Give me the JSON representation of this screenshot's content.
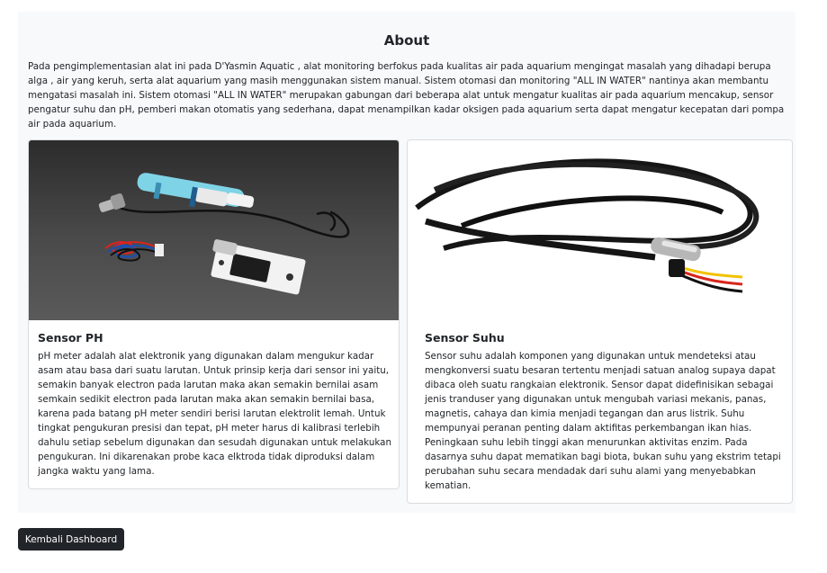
{
  "about": {
    "title": "About",
    "description": "Pada pengimplementasian alat ini pada D'Yasmin Aquatic , alat monitoring berfokus pada kualitas air pada aquarium mengingat masalah yang dihadapi berupa alga , air yang keruh, serta alat aquarium yang masih menggunakan sistem manual. Sistem otomasi dan monitoring \"ALL IN WATER\" nantinya akan membantu mengatasi masalah ini. Sistem otomasi \"ALL IN WATER\" merupakan gabungan dari beberapa alat untuk mengatur kualitas air pada aquarium mencakup, sensor pengatur suhu dan pH, pemberi makan otomatis yang sederhana, dapat menampilkan kadar oksigen pada aquarium serta dapat mengatur kecepatan dari pompa air pada aquarium."
  },
  "cards": [
    {
      "title": "Sensor PH",
      "text": "pH meter adalah alat elektronik yang digunakan dalam mengukur kadar asam atau basa dari suatu larutan. Untuk prinsip kerja dari sensor ini yaitu, semakin banyak electron pada larutan maka akan semakin bernilai asam semkain sedikit electron pada larutan maka akan semakin bernilai basa, karena pada batang pH meter sendiri berisi larutan elektrolit lemah. Untuk tingkat pengukuran presisi dan tepat, pH meter harus di kalibrasi terlebih dahulu setiap sebelum digunakan dan sesudah digunakan untuk melakukan pengukuran. Ini dikarenakan probe kaca elktroda tidak diproduksi dalam jangka waktu yang lama."
    },
    {
      "title": "Sensor Suhu",
      "text": "Sensor suhu adalah komponen yang digunakan untuk mendeteksi atau mengkonversi suatu besaran tertentu menjadi satuan analog supaya dapat dibaca oleh suatu rangkaian elektronik. Sensor dapat didefinisikan sebagai jenis tranduser yang digunakan untuk mengubah variasi mekanis, panas, magnetis, cahaya dan kimia menjadi tegangan dan arus listrik. Suhu mempunyai peranan penting dalam aktifitas perkembangan ikan hias. Peningkaan suhu lebih tinggi akan menurunkan aktivitas enzim. Pada dasarnya suhu dapat mematikan bagi biota, bukan suhu yang ekstrim tetapi perubahan suhu secara mendadak dari suhu alami yang menyebabkan kematian."
    }
  ],
  "button": {
    "label": "Kembali Dashboard"
  }
}
